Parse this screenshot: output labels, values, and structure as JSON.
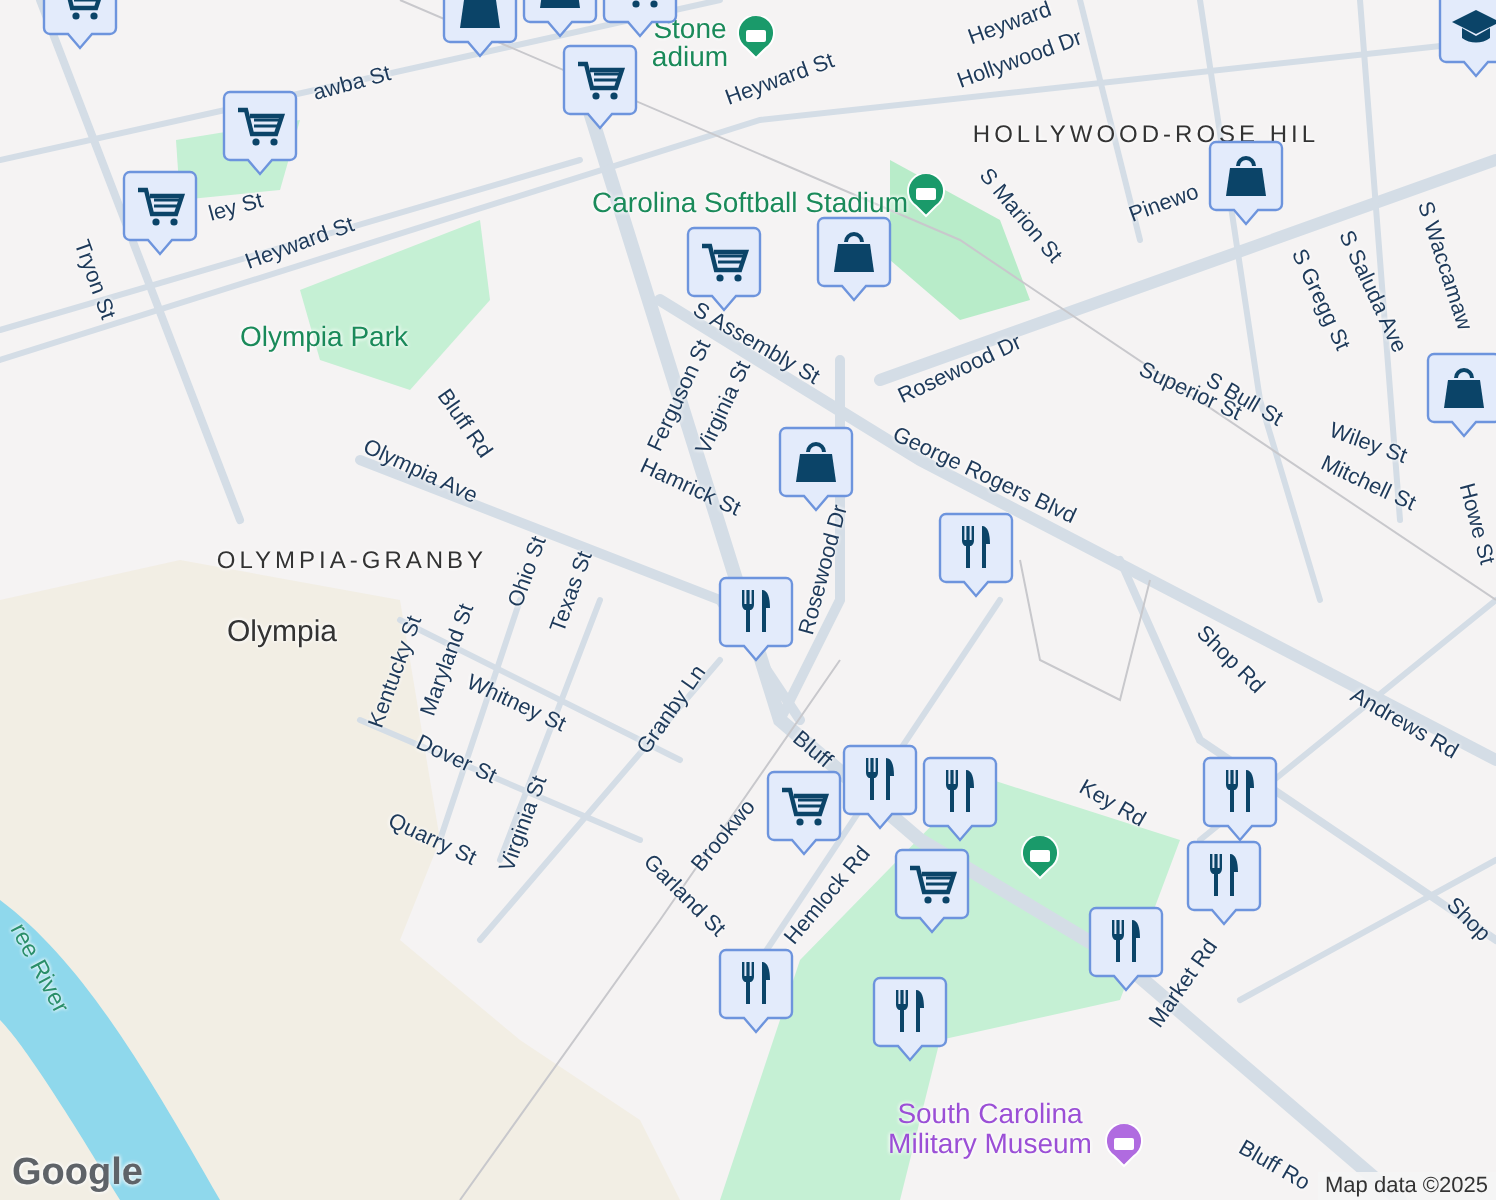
{
  "map": {
    "labels": [
      {
        "kind": "street",
        "text": "awba St"
      },
      {
        "kind": "street",
        "text": "ley St"
      },
      {
        "kind": "street",
        "text": "Heyward St"
      },
      {
        "kind": "street",
        "text": "Tryon St"
      },
      {
        "kind": "street",
        "text": "Heyward St"
      },
      {
        "kind": "street",
        "text": "Heyward"
      },
      {
        "kind": "street",
        "text": "Hollywood Dr"
      },
      {
        "kind": "street",
        "text": "S Marion St"
      },
      {
        "kind": "street",
        "text": "Pinewo"
      },
      {
        "kind": "street",
        "text": "S Gregg St"
      },
      {
        "kind": "street",
        "text": "S Saluda Ave"
      },
      {
        "kind": "street",
        "text": "S Waccamaw"
      },
      {
        "kind": "street",
        "text": "Rosewood Dr"
      },
      {
        "kind": "street",
        "text": "Superior St"
      },
      {
        "kind": "street",
        "text": "S Bull St"
      },
      {
        "kind": "street",
        "text": "Wiley St"
      },
      {
        "kind": "street",
        "text": "Mitchell St"
      },
      {
        "kind": "street",
        "text": "George Rogers Blvd"
      },
      {
        "kind": "street",
        "text": "Rosewood Dr"
      },
      {
        "kind": "street",
        "text": "S Assembly St"
      },
      {
        "kind": "street",
        "text": "Ferguson St"
      },
      {
        "kind": "street",
        "text": "Virginia St"
      },
      {
        "kind": "street",
        "text": "Hamrick St"
      },
      {
        "kind": "street",
        "text": "Bluff Rd"
      },
      {
        "kind": "street",
        "text": "Olympia Ave"
      },
      {
        "kind": "street",
        "text": "Kentucky St"
      },
      {
        "kind": "street",
        "text": "Maryland St"
      },
      {
        "kind": "street",
        "text": "Ohio St"
      },
      {
        "kind": "street",
        "text": "Texas St"
      },
      {
        "kind": "street",
        "text": "Whitney St"
      },
      {
        "kind": "street",
        "text": "Dover St"
      },
      {
        "kind": "street",
        "text": "Quarry St"
      },
      {
        "kind": "street",
        "text": "Virginia St"
      },
      {
        "kind": "street",
        "text": "Granby Ln"
      },
      {
        "kind": "street",
        "text": "Garland St"
      },
      {
        "kind": "street",
        "text": "Brookwo"
      },
      {
        "kind": "street",
        "text": "Hemlock Rd"
      },
      {
        "kind": "street",
        "text": "Bluff"
      },
      {
        "kind": "street",
        "text": "Key Rd"
      },
      {
        "kind": "street",
        "text": "Market Rd"
      },
      {
        "kind": "street",
        "text": "Shop Rd"
      },
      {
        "kind": "street",
        "text": "Andrews Rd"
      },
      {
        "kind": "street",
        "text": "Shop"
      },
      {
        "kind": "street",
        "text": "Bluff Ro"
      },
      {
        "kind": "street",
        "text": "Howe St"
      },
      {
        "kind": "area",
        "text": "HOLLYWOOD-ROSE HIL"
      },
      {
        "kind": "area",
        "text": "OLYMPIA-GRANBY"
      },
      {
        "kind": "place",
        "text": "Olympia"
      },
      {
        "kind": "park",
        "text": "Stone"
      },
      {
        "kind": "park",
        "text": "adium"
      },
      {
        "kind": "park",
        "text": "Carolina Softball Stadium"
      },
      {
        "kind": "park",
        "text": "Olympia Park"
      },
      {
        "kind": "water",
        "text": "ree River"
      },
      {
        "kind": "museum",
        "text": "South Carolina Military Museum"
      }
    ],
    "markers": [
      {
        "kind": "cart"
      },
      {
        "kind": "bag"
      },
      {
        "kind": "bag"
      },
      {
        "kind": "cart"
      },
      {
        "kind": "cart"
      },
      {
        "kind": "cart"
      },
      {
        "kind": "cart"
      },
      {
        "kind": "bag"
      },
      {
        "kind": "school"
      },
      {
        "kind": "cart"
      },
      {
        "kind": "bag"
      },
      {
        "kind": "bag"
      },
      {
        "kind": "bag"
      },
      {
        "kind": "fork"
      },
      {
        "kind": "fork"
      },
      {
        "kind": "fork"
      },
      {
        "kind": "cart"
      },
      {
        "kind": "fork"
      },
      {
        "kind": "cart"
      },
      {
        "kind": "fork"
      },
      {
        "kind": "fork"
      },
      {
        "kind": "fork"
      },
      {
        "kind": "fork"
      },
      {
        "kind": "fork"
      }
    ],
    "attribution": {
      "logo": "Google",
      "text": "Map data ©2025"
    }
  }
}
